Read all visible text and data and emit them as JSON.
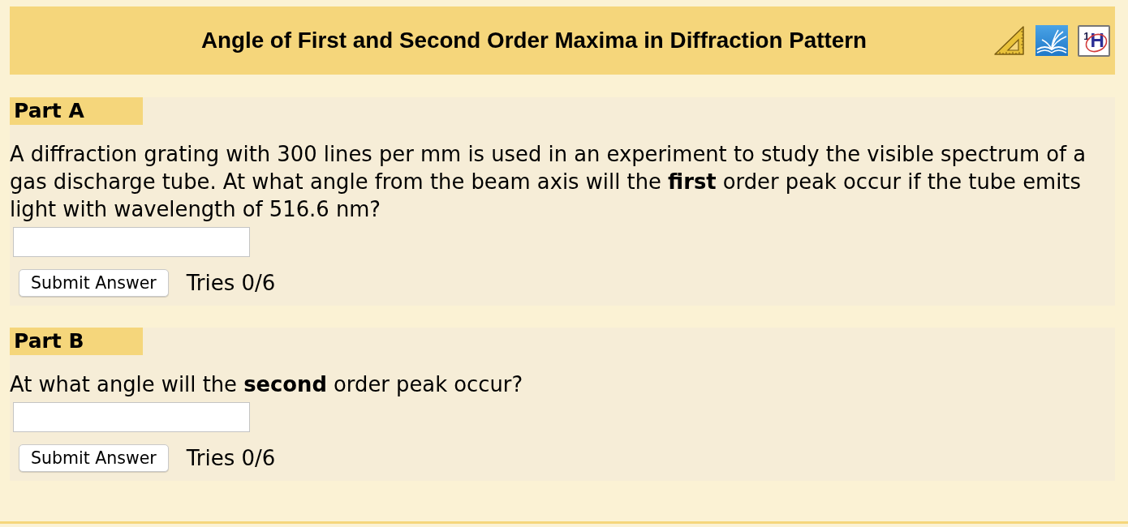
{
  "header": {
    "title": "Angle of First and Second Order Maxima in Diffraction Pattern",
    "tools": [
      {
        "kind": "set_square"
      },
      {
        "kind": "book"
      },
      {
        "kind": "nmr",
        "label": "$^{1}$H"
      }
    ]
  },
  "parts": [
    {
      "label": "Part A",
      "question": "A diffraction grating with 300 lines per mm is used in an experiment to study the visible spectrum of a gas discharge tube. At what angle from the beam axis will the **first** order peak occur if the tube emits light with wavelength of 516.6 nm?",
      "button": "Submit Answer",
      "tries": "Tries 0/6"
    },
    {
      "label": "Part B",
      "question": "At what angle will the **second** order peak occur?",
      "button": "Submit Answer",
      "tries": "Tries 0/6"
    }
  ]
}
